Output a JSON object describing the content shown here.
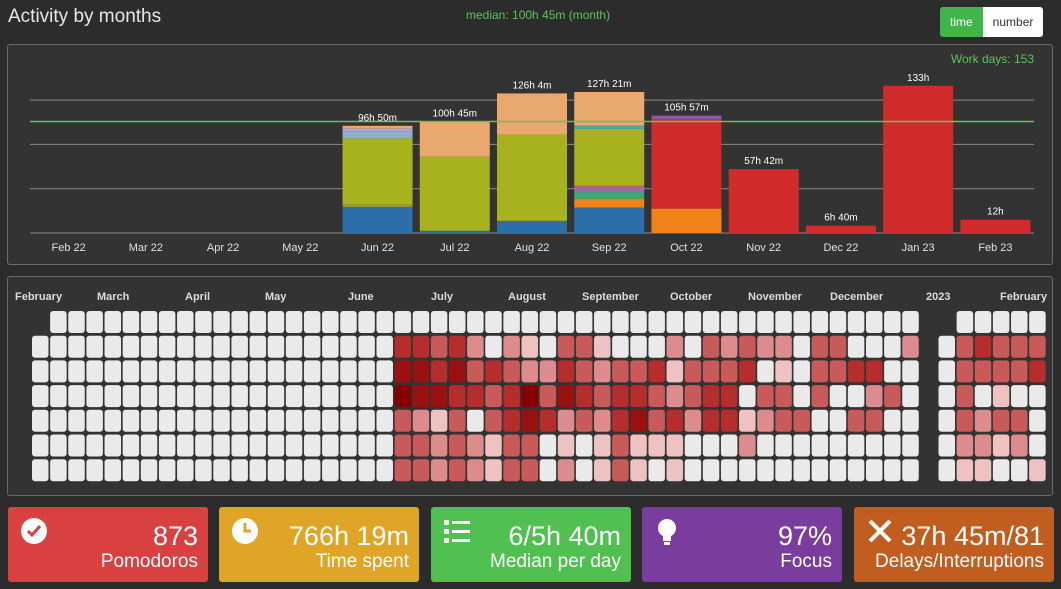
{
  "header": {
    "title": "Activity by months",
    "median": "median: 100h 45m (month)",
    "toggle": {
      "time": "time",
      "number": "number"
    }
  },
  "chart_data": {
    "type": "bar",
    "work_days": "Work days: 153",
    "categories": [
      "Feb 22",
      "Mar 22",
      "Apr 22",
      "May 22",
      "Jun 22",
      "Jul 22",
      "Aug 22",
      "Sep 22",
      "Oct 22",
      "Nov 22",
      "Dec 22",
      "Jan 23",
      "Feb 23"
    ],
    "totals_h": [
      0,
      0,
      0,
      0,
      96.83,
      100.75,
      126.07,
      127.35,
      105.95,
      57.7,
      6.67,
      133,
      12
    ],
    "labels": [
      "",
      "",
      "",
      "",
      "96h 50m",
      "100h 45m",
      "126h 4m",
      "127h 21m",
      "105h 57m",
      "57h 42m",
      "6h 40m",
      "133h",
      "12h"
    ],
    "median_h": 100.75,
    "ylim": [
      0,
      140
    ],
    "gridlines": [
      40,
      80,
      120
    ],
    "stacks": [
      [],
      [],
      [],
      [],
      [
        {
          "v": 23.5,
          "c": "#2b6ea8"
        },
        {
          "v": 2,
          "c": "#9a8e46"
        },
        {
          "v": 60,
          "c": "#a8b21e"
        },
        {
          "v": 6,
          "c": "#8fb0cc"
        },
        {
          "v": 3,
          "c": "#b4a7cf"
        },
        {
          "v": 2.33,
          "c": "#e8a86e"
        }
      ],
      [
        {
          "v": 2,
          "c": "#2b6ea8"
        },
        {
          "v": 67,
          "c": "#a8b21e"
        },
        {
          "v": 31.75,
          "c": "#e8a86e"
        }
      ],
      [
        {
          "v": 11,
          "c": "#2b6ea8"
        },
        {
          "v": 78,
          "c": "#a8b21e"
        },
        {
          "v": 37.07,
          "c": "#e8a86e"
        }
      ],
      [
        {
          "v": 23,
          "c": "#2b6ea8"
        },
        {
          "v": 8,
          "c": "#f08218"
        },
        {
          "v": 6,
          "c": "#3aaa7a"
        },
        {
          "v": 4,
          "c": "#9a6aa8"
        },
        {
          "v": 2,
          "c": "#c46a6a"
        },
        {
          "v": 51,
          "c": "#a8b21e"
        },
        {
          "v": 3,
          "c": "#4aaa9a"
        },
        {
          "v": 30.35,
          "c": "#e8a86e"
        }
      ],
      [
        {
          "v": 22,
          "c": "#f08218"
        },
        {
          "v": 81,
          "c": "#d22b2b"
        },
        {
          "v": 2.95,
          "c": "#8a5aa8"
        }
      ],
      [
        {
          "v": 57.7,
          "c": "#d22b2b"
        }
      ],
      [
        {
          "v": 6.67,
          "c": "#d22b2b"
        }
      ],
      [
        {
          "v": 133,
          "c": "#d22b2b"
        }
      ],
      [
        {
          "v": 12,
          "c": "#d22b2b"
        }
      ]
    ]
  },
  "heatmap": {
    "month_labels": [
      "February",
      "March",
      "April",
      "May",
      "June",
      "July",
      "August",
      "September",
      "October",
      "November",
      "December",
      "2023",
      "February"
    ],
    "shade_colors": [
      "#eaeaea",
      "#efc2c2",
      "#dc8c8c",
      "#c95a5a",
      "#b52d2d",
      "#9a1111",
      "#860000"
    ],
    "weeks": [
      [
        null,
        0,
        0,
        0,
        0,
        0,
        0
      ],
      [
        0,
        0,
        0,
        0,
        0,
        0,
        0
      ],
      [
        0,
        0,
        0,
        0,
        0,
        0,
        0
      ],
      [
        0,
        0,
        0,
        0,
        0,
        0,
        0
      ],
      [
        0,
        0,
        0,
        0,
        0,
        0,
        0
      ],
      [
        0,
        0,
        0,
        0,
        0,
        0,
        0
      ],
      [
        0,
        0,
        0,
        0,
        0,
        0,
        0
      ],
      [
        0,
        0,
        0,
        0,
        0,
        0,
        0
      ],
      [
        0,
        0,
        0,
        0,
        0,
        0,
        0
      ],
      [
        0,
        0,
        0,
        0,
        0,
        0,
        0
      ],
      [
        0,
        0,
        0,
        0,
        0,
        0,
        0
      ],
      [
        0,
        0,
        0,
        0,
        0,
        0,
        0
      ],
      [
        0,
        0,
        0,
        0,
        0,
        0,
        0
      ],
      [
        0,
        0,
        0,
        0,
        0,
        0,
        0
      ],
      [
        0,
        0,
        0,
        0,
        0,
        0,
        0
      ],
      [
        0,
        0,
        0,
        0,
        0,
        0,
        0
      ],
      [
        0,
        0,
        0,
        0,
        0,
        0,
        0
      ],
      [
        0,
        0,
        0,
        0,
        0,
        0,
        0
      ],
      [
        0,
        0,
        0,
        0,
        0,
        0,
        0
      ],
      [
        0,
        0,
        0,
        0,
        0,
        0,
        0
      ],
      [
        0,
        4,
        5,
        6,
        3,
        3,
        3
      ],
      [
        0,
        4,
        5,
        5,
        2,
        3,
        3
      ],
      [
        0,
        3,
        4,
        5,
        1,
        2,
        2
      ],
      [
        0,
        4,
        5,
        4,
        3,
        3,
        3
      ],
      [
        0,
        2,
        3,
        4,
        0,
        2,
        2
      ],
      [
        0,
        0,
        4,
        3,
        3,
        1,
        1
      ],
      [
        0,
        2,
        3,
        4,
        4,
        3,
        3
      ],
      [
        0,
        1,
        2,
        6,
        5,
        3,
        3
      ],
      [
        0,
        0,
        2,
        3,
        4,
        0,
        0
      ],
      [
        0,
        3,
        4,
        5,
        2,
        1,
        2
      ],
      [
        0,
        3,
        3,
        4,
        3,
        0,
        0
      ],
      [
        0,
        1,
        2,
        3,
        2,
        1,
        1
      ],
      [
        0,
        0,
        3,
        4,
        4,
        3,
        3
      ],
      [
        0,
        0,
        3,
        4,
        5,
        1,
        1
      ],
      [
        0,
        0,
        4,
        3,
        3,
        1,
        0
      ],
      [
        0,
        2,
        1,
        2,
        4,
        1,
        1
      ],
      [
        0,
        0,
        3,
        3,
        2,
        0,
        0
      ],
      [
        0,
        3,
        3,
        4,
        4,
        0,
        0
      ],
      [
        0,
        2,
        3,
        4,
        4,
        0,
        0
      ],
      [
        0,
        3,
        4,
        0,
        1,
        2,
        0
      ],
      [
        0,
        2,
        0,
        3,
        2,
        0,
        0
      ],
      [
        0,
        2,
        1,
        3,
        3,
        0,
        0
      ],
      [
        0,
        0,
        0,
        0,
        3,
        0,
        0
      ],
      [
        0,
        3,
        3,
        3,
        0,
        0,
        0
      ],
      [
        0,
        3,
        3,
        0,
        0,
        0,
        0
      ],
      [
        0,
        0,
        4,
        0,
        3,
        0,
        0
      ],
      [
        0,
        0,
        4,
        2,
        3,
        0,
        0
      ],
      [
        0,
        0,
        0,
        3,
        0,
        0,
        0
      ],
      [
        0,
        2,
        0,
        0,
        0,
        0,
        0
      ],
      null,
      [
        null,
        0,
        0,
        0,
        0,
        0,
        0
      ],
      [
        0,
        3,
        3,
        3,
        3,
        2,
        1
      ],
      [
        0,
        4,
        3,
        0,
        2,
        2,
        1
      ],
      [
        0,
        3,
        3,
        1,
        3,
        1,
        0
      ],
      [
        0,
        3,
        3,
        0,
        3,
        2,
        0
      ],
      [
        0,
        3,
        4,
        0,
        0,
        0,
        1
      ]
    ]
  },
  "stats": [
    {
      "value": "873",
      "label": "Pomodoros",
      "color": "#d94040",
      "icon": "check-circle-icon"
    },
    {
      "value": "766h 19m",
      "label": "Time spent",
      "color": "#e0a526",
      "icon": "clock-icon"
    },
    {
      "value": "6/5h 40m",
      "label": "Median per day",
      "color": "#50c050",
      "icon": "list-icon"
    },
    {
      "value": "97%",
      "label": "Focus",
      "color": "#7a3d9e",
      "icon": "lightbulb-icon"
    },
    {
      "value": "37h 45m/81",
      "label": "Delays/Interruptions",
      "color": "#c05d1f",
      "icon": "close-icon"
    }
  ]
}
